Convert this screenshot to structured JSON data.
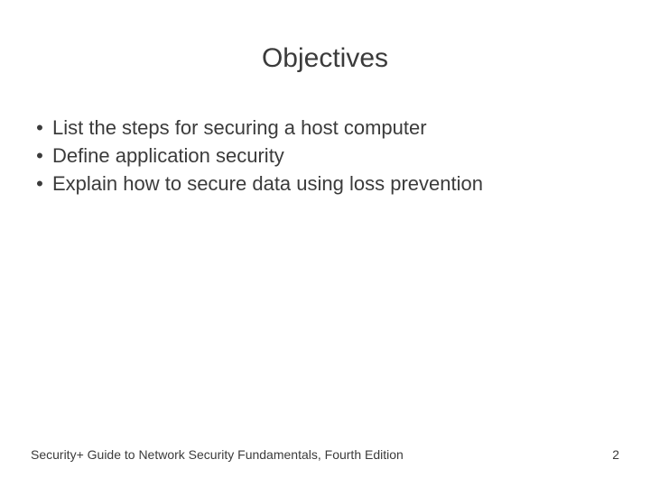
{
  "title": "Objectives",
  "bullets": {
    "b0": "List the steps for securing a host computer",
    "b1": "Define application security",
    "b2": "Explain how to secure data using loss prevention"
  },
  "footer": {
    "text": "Security+ Guide to Network Security Fundamentals, Fourth Edition",
    "page": "2"
  }
}
